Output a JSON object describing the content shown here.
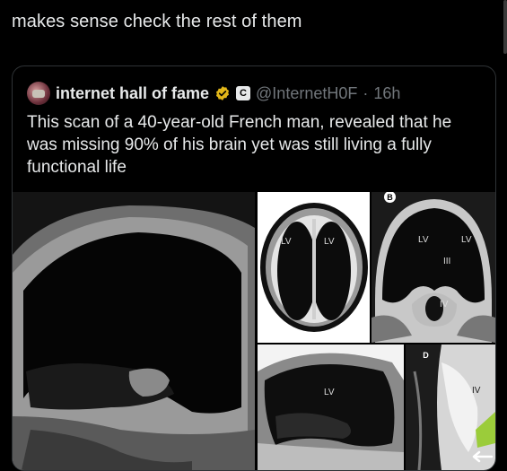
{
  "reply": {
    "text": "makes sense check the rest of them"
  },
  "quote": {
    "author_name": "internet hall of fame",
    "affiliate_badge": "C",
    "handle": "@InternetH0F",
    "separator": "·",
    "time": "16h",
    "text": "This scan of a 40-year-old French man, revealed that he was missing 90% of his brain yet was still living a fully functional life"
  },
  "media": {
    "panel_b_letter": "B",
    "panel_d_letter": "D",
    "labels": {
      "top_left_lv_1": "LV",
      "top_left_lv_2": "LV",
      "top_right_lv_1": "LV",
      "top_right_lv_2": "LV",
      "top_right_iii": "III",
      "top_right_iv": "IV",
      "bottom_center_lv": "LV",
      "bottom_right_iv": "IV"
    }
  },
  "icons": [
    "avatar",
    "verified-badge-icon",
    "affiliate-badge-icon",
    "arrow-left-icon"
  ],
  "colors": {
    "background": "#000000",
    "text": "#e7e9ea",
    "muted": "#71767b",
    "border": "#2f3336",
    "verified": "#e2b719"
  }
}
